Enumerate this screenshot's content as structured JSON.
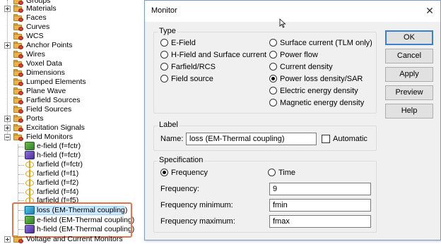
{
  "tree": {
    "items": [
      {
        "label": "Groups",
        "icon": "folder-icon",
        "expander": "none"
      },
      {
        "label": "Materials",
        "icon": "folder-icon",
        "expander": "plus"
      },
      {
        "label": "Faces",
        "icon": "folder-icon",
        "expander": "none"
      },
      {
        "label": "Curves",
        "icon": "folder-icon",
        "expander": "none"
      },
      {
        "label": "WCS",
        "icon": "folder-icon",
        "expander": "none"
      },
      {
        "label": "Anchor Points",
        "icon": "folder-icon",
        "expander": "plus"
      },
      {
        "label": "Wires",
        "icon": "folder-icon",
        "expander": "none"
      },
      {
        "label": "Voxel Data",
        "icon": "folder-icon",
        "expander": "none"
      },
      {
        "label": "Dimensions",
        "icon": "folder-icon",
        "expander": "none"
      },
      {
        "label": "Lumped Elements",
        "icon": "folder-icon",
        "expander": "none"
      },
      {
        "label": "Plane Wave",
        "icon": "folder-icon",
        "expander": "none"
      },
      {
        "label": "Farfield Sources",
        "icon": "folder-icon",
        "expander": "none"
      },
      {
        "label": "Field Sources",
        "icon": "folder-icon",
        "expander": "none"
      },
      {
        "label": "Ports",
        "icon": "folder-icon",
        "expander": "plus"
      },
      {
        "label": "Excitation Signals",
        "icon": "folder-icon",
        "expander": "plus"
      },
      {
        "label": "Field Monitors",
        "icon": "folder-icon",
        "expander": "minus"
      }
    ],
    "monitors": [
      {
        "label": "e-field (f=fctr)",
        "icon": "green"
      },
      {
        "label": "h-field (f=fctr)",
        "icon": "purple"
      },
      {
        "label": "farfield (f=fctr)",
        "icon": "farfield"
      },
      {
        "label": "farfield (f=f1)",
        "icon": "farfield"
      },
      {
        "label": "farfield (f=f2)",
        "icon": "farfield"
      },
      {
        "label": "farfield (f=f4)",
        "icon": "farfield"
      },
      {
        "label": "farfield (f=f5)",
        "icon": "farfield"
      },
      {
        "label": "loss (EM-Thermal coupling)",
        "icon": "cyan"
      },
      {
        "label": "e-field (EM-Thermal coupling)",
        "icon": "green"
      },
      {
        "label": "h-field (EM-Thermal coupling)",
        "icon": "purple"
      }
    ],
    "last_item": "Voltage and Current Monitors"
  },
  "dialog": {
    "title": "Monitor",
    "close_glyph": "✕",
    "type_group": {
      "title": "Type",
      "left_options": [
        "E-Field",
        "H-Field and Surface current",
        "Farfield/RCS",
        "Field source"
      ],
      "right_options": [
        "Surface current (TLM only)",
        "Power flow",
        "Current density",
        "Power loss density/SAR",
        "Electric energy density",
        "Magnetic energy density"
      ],
      "selected": "Power loss density/SAR"
    },
    "label_group": {
      "title": "Label",
      "name_label": "Name:",
      "name_value": "loss (EM-Thermal coupling)",
      "automatic_label": "Automatic",
      "automatic_checked": false
    },
    "spec_group": {
      "title": "Specification",
      "frequency_radio": "Frequency",
      "time_radio": "Time",
      "selected": "Frequency",
      "frequency_label": "Frequency:",
      "frequency_value": "9",
      "freq_min_label": "Frequency minimum:",
      "freq_min_value": "fmin",
      "freq_max_label": "Frequency maximum:",
      "freq_max_value": "fmax"
    },
    "buttons": [
      "OK",
      "Cancel",
      "Apply",
      "Preview",
      "Help"
    ]
  },
  "colors": {
    "highlight_border": "#e8704a",
    "default_button_border": "#3c7fd1",
    "folder": "#e8b34a"
  }
}
